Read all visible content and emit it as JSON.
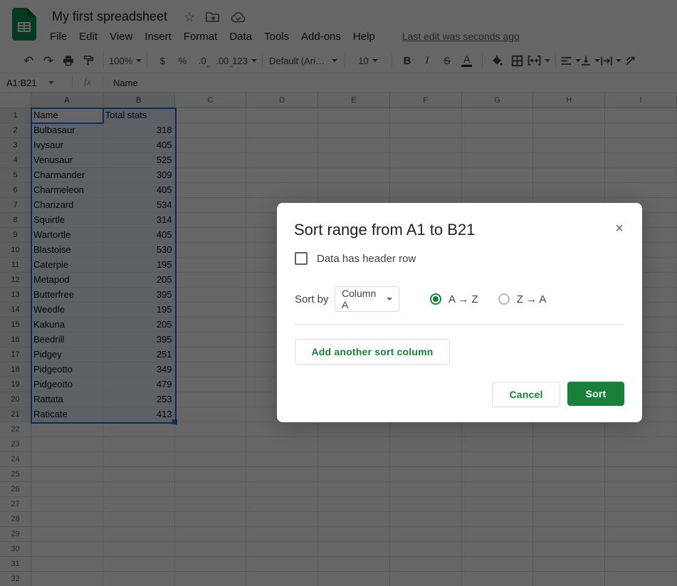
{
  "header": {
    "title": "My first spreadsheet",
    "menu": [
      "File",
      "Edit",
      "View",
      "Insert",
      "Format",
      "Data",
      "Tools",
      "Add-ons",
      "Help"
    ],
    "last_edit": "Last edit was seconds ago"
  },
  "icons": {
    "star": "☆",
    "undo": "↶",
    "redo": "↷",
    "close": "×",
    "decimal_decrease_arrow": "←",
    "decimal_increase_arrow": "→"
  },
  "toolbar": {
    "zoom": "100%",
    "currency": "$",
    "percent": "%",
    "decimal_decrease": ".0",
    "decimal_increase": ".00",
    "more_formats": "123",
    "font": "Default (Ari…",
    "font_size": "10",
    "bold": "B",
    "italic": "I",
    "strikethrough": "S",
    "text_color": "A"
  },
  "formula_bar": {
    "name_box": "A1:B21",
    "fx": "fx",
    "value": "Name"
  },
  "grid": {
    "columns": [
      "A",
      "B",
      "C",
      "D",
      "E",
      "F",
      "G",
      "H",
      "I"
    ],
    "selected_columns": [
      "A",
      "B"
    ],
    "rows_total": 32,
    "selected_rows_through": 21,
    "selected_range": "A1:B21",
    "active_cell": "A1",
    "data": [
      [
        "Name",
        "Total stats"
      ],
      [
        "Bulbasaur",
        "318"
      ],
      [
        "Ivysaur",
        "405"
      ],
      [
        "Venusaur",
        "525"
      ],
      [
        "Charmander",
        "309"
      ],
      [
        "Charmeleon",
        "405"
      ],
      [
        "Charizard",
        "534"
      ],
      [
        "Squirtle",
        "314"
      ],
      [
        "Wartortle",
        "405"
      ],
      [
        "Blastoise",
        "530"
      ],
      [
        "Caterpie",
        "195"
      ],
      [
        "Metapod",
        "205"
      ],
      [
        "Butterfree",
        "395"
      ],
      [
        "Weedle",
        "195"
      ],
      [
        "Kakuna",
        "205"
      ],
      [
        "Beedrill",
        "395"
      ],
      [
        "Pidgey",
        "251"
      ],
      [
        "Pidgeotto",
        "349"
      ],
      [
        "Pidgeotto",
        "479"
      ],
      [
        "Rattata",
        "253"
      ],
      [
        "Raticate",
        "413"
      ]
    ]
  },
  "dialog": {
    "title": "Sort range from A1 to B21",
    "header_row_checkbox": {
      "label": "Data has header row",
      "checked": false
    },
    "sort_by_label": "Sort by",
    "column_select_value": "Column A",
    "order_options": [
      {
        "label": "A → Z",
        "selected": true
      },
      {
        "label": "Z → A",
        "selected": false
      }
    ],
    "add_sort_column_label": "Add another sort column",
    "cancel_label": "Cancel",
    "sort_label": "Sort"
  },
  "colors": {
    "primary_green": "#188038",
    "selection_blue": "#1a73e8",
    "scrim": "rgba(0,0,0,0.6)"
  }
}
